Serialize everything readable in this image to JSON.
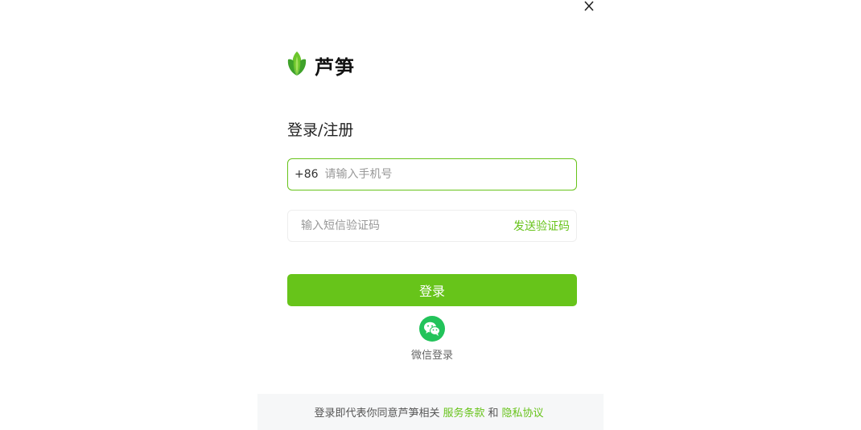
{
  "brand": {
    "name": "芦笋",
    "accent_color": "#67c31a"
  },
  "form": {
    "title": "登录/注册",
    "phone_prefix": "+86",
    "phone_placeholder": "请输入手机号",
    "code_placeholder": "输入短信验证码",
    "send_code_label": "发送验证码",
    "login_label": "登录"
  },
  "wechat": {
    "label": "微信登录",
    "icon": "wechat-icon"
  },
  "footer": {
    "prefix": "登录即代表你同意芦笋相关",
    "terms_label": "服务条款",
    "conjunction": "和",
    "privacy_label": "隐私协议"
  }
}
